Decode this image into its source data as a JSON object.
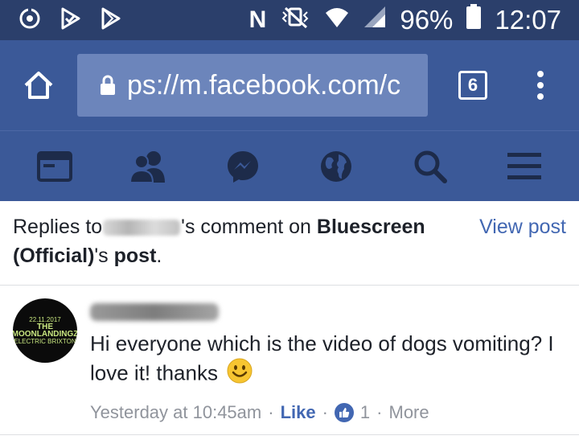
{
  "status": {
    "battery": "96%",
    "time": "12:07",
    "network_letter": "N"
  },
  "browser": {
    "url": "ps://m.facebook.com/c",
    "tab_count": "6"
  },
  "header": {
    "prefix": "Replies to",
    "mid": "'s comment on",
    "page_name": "Bluescreen (Official)",
    "suffix": "'s",
    "post_word": "post",
    "period": ".",
    "view_post": "View post"
  },
  "comment": {
    "text": "Hi everyone which is the video of dogs vomiting? I love it! thanks",
    "time": "Yesterday at 10:45am",
    "like_label": "Like",
    "like_count": "1",
    "more_label": "More",
    "sep": "·"
  },
  "avatar": {
    "date": "22.11.2017",
    "title": "THE MOONLANDINGZ",
    "line": "ELECTRIC BRIXTON"
  },
  "colors": {
    "facebook_blue": "#3b5998",
    "status_bar": "#2b3f6b",
    "link_blue": "#4267b2"
  }
}
